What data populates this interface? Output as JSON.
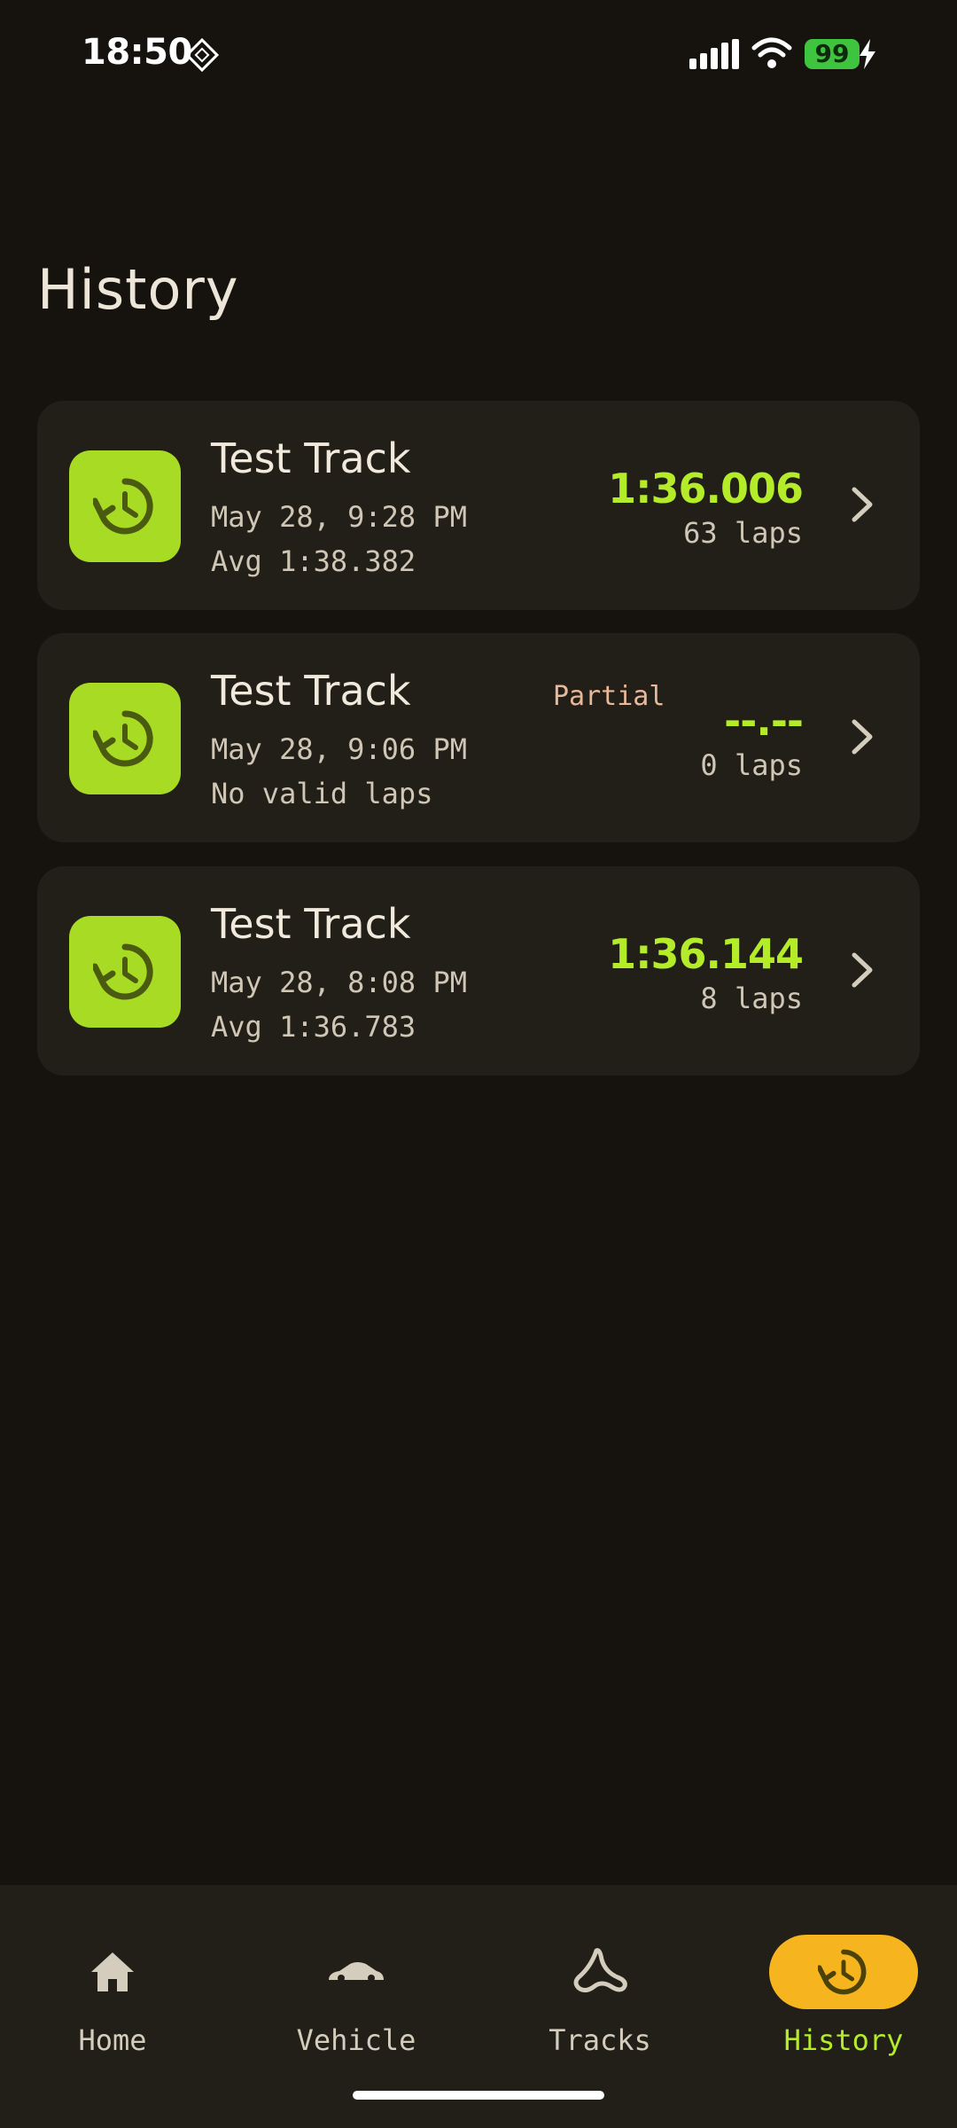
{
  "status_bar": {
    "time": "18:50",
    "battery": "99",
    "icons": [
      "signal-icon",
      "wifi-icon",
      "battery-icon",
      "charging-icon",
      "diamond-icon"
    ]
  },
  "page": {
    "title": "History"
  },
  "sessions": [
    {
      "track": "Test Track",
      "date": "May 28, 9:28 PM",
      "sub": "Avg 1:38.382",
      "best": "1:36.006",
      "laps": "63 laps",
      "badge": ""
    },
    {
      "track": "Test Track",
      "date": "May 28, 9:06 PM",
      "sub": "No valid laps",
      "best": "--.--",
      "laps": "0 laps",
      "badge": "Partial"
    },
    {
      "track": "Test Track",
      "date": "May 28, 8:08 PM",
      "sub": "Avg 1:36.783",
      "best": "1:36.144",
      "laps": "8 laps",
      "badge": ""
    }
  ],
  "nav": {
    "items": [
      {
        "label": "Home",
        "icon": "home-icon"
      },
      {
        "label": "Vehicle",
        "icon": "car-icon"
      },
      {
        "label": "Tracks",
        "icon": "track-icon"
      },
      {
        "label": "History",
        "icon": "history-icon",
        "active": true
      }
    ]
  },
  "colors": {
    "background": "#16130e",
    "card": "#221f19",
    "accent_green": "#b4ec2a",
    "icon_green": "#a8db23",
    "accent_yellow": "#f6b51e",
    "partial": "#e8b89a"
  }
}
